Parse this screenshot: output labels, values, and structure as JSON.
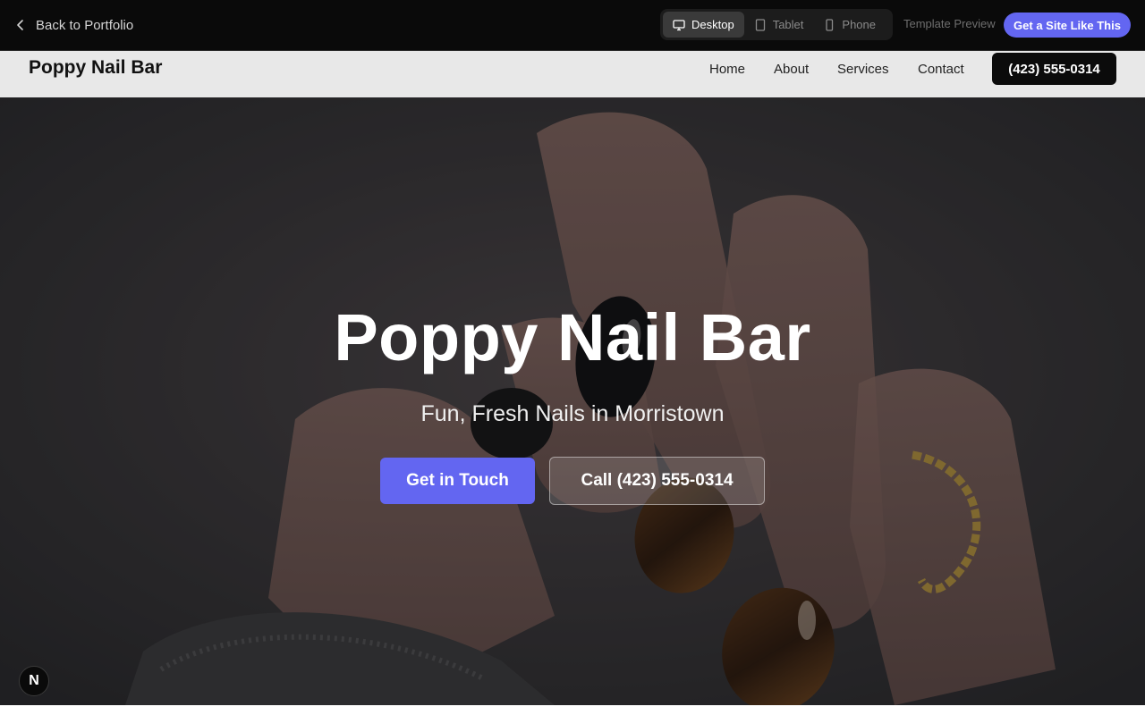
{
  "preview_bar": {
    "back_label": "Back to Portfolio",
    "devices": [
      {
        "label": "Desktop",
        "icon": "monitor-icon",
        "active": true
      },
      {
        "label": "Tablet",
        "icon": "tablet-icon",
        "active": false
      },
      {
        "label": "Phone",
        "icon": "phone-icon",
        "active": false
      }
    ],
    "template_label": "Template Preview",
    "cta_label": "Get a Site Like This"
  },
  "site": {
    "brand": "Poppy Nail Bar",
    "nav": [
      "Home",
      "About",
      "Services",
      "Contact"
    ],
    "phone_button": "(423) 555-0314"
  },
  "hero": {
    "title": "Poppy Nail Bar",
    "subtitle": "Fun, Fresh Nails in Morristown",
    "primary_button": "Get in Touch",
    "secondary_button": "Call (423) 555-0314"
  },
  "badge": {
    "label": "N"
  },
  "colors": {
    "accent": "#6366f1",
    "topbar": "#0a0a0a",
    "nav_bg": "#e8e8e8"
  }
}
